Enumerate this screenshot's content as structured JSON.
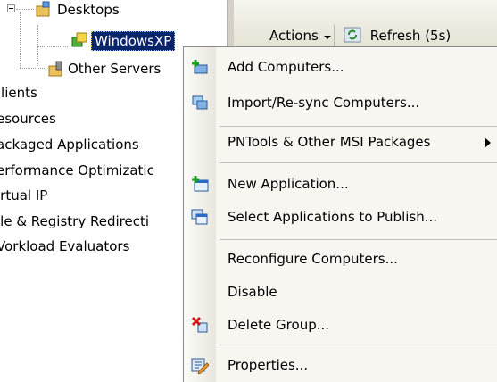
{
  "tree": {
    "items": [
      {
        "label": "Desktops"
      },
      {
        "label": "WindowsXP"
      },
      {
        "label": "Other Servers"
      },
      {
        "label": ":lients"
      },
      {
        "label": "esources"
      },
      {
        "label": "ackaged Applications"
      },
      {
        "label": "erformance Optimizatic"
      },
      {
        "label": "irtual IP"
      },
      {
        "label": "ile & Registry Redirecti"
      },
      {
        "label": "Vorkload Evaluators"
      }
    ]
  },
  "toolbar": {
    "actions_label": "Actions",
    "refresh_label": "Refresh (5s)"
  },
  "context_menu": {
    "items": [
      {
        "label": "Add Computers...",
        "icon": "add-computer-icon"
      },
      {
        "label": "Import/Re-sync Computers...",
        "icon": "import-computers-icon"
      },
      {
        "label": "PNTools & Other MSI Packages",
        "icon": "",
        "submenu": true
      },
      {
        "label": "New Application...",
        "icon": "new-application-icon"
      },
      {
        "label": "Select Applications to Publish...",
        "icon": "select-applications-icon"
      },
      {
        "label": "Reconfigure Computers...",
        "icon": ""
      },
      {
        "label": "Disable",
        "icon": ""
      },
      {
        "label": "Delete Group...",
        "icon": "delete-group-icon"
      },
      {
        "label": "Properties...",
        "icon": "properties-icon"
      }
    ]
  },
  "colors": {
    "selection": "#0a246a",
    "menu_background": "#f7f6f0",
    "toolbar_background": "#ece9d8"
  }
}
